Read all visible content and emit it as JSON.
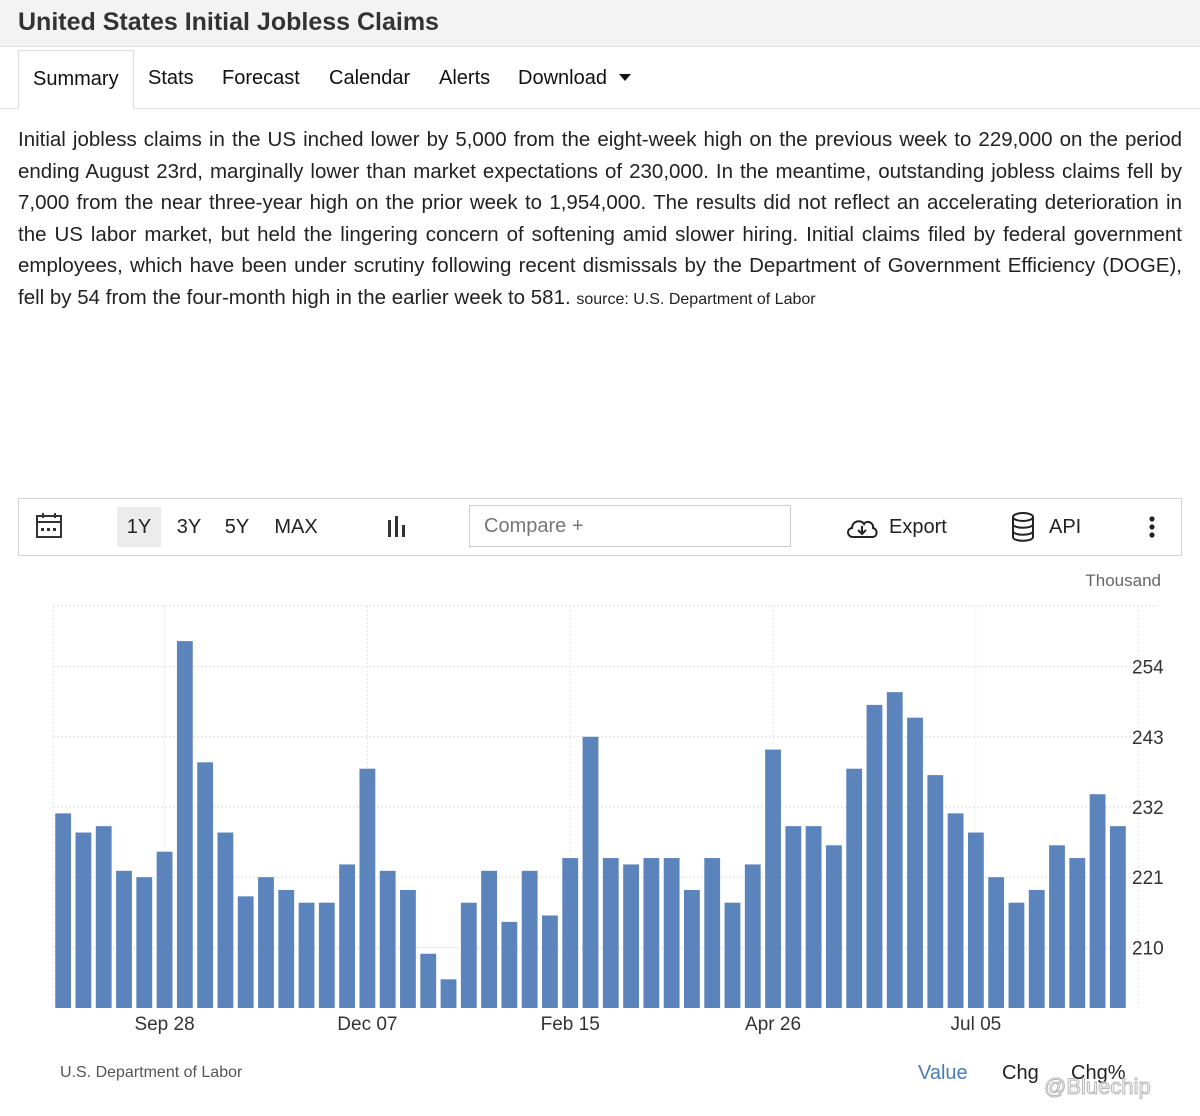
{
  "page": {
    "title": "United States Initial Jobless Claims"
  },
  "tabs": [
    {
      "label": "Summary"
    },
    {
      "label": "Stats"
    },
    {
      "label": "Forecast"
    },
    {
      "label": "Calendar"
    },
    {
      "label": "Alerts"
    },
    {
      "label": "Download"
    }
  ],
  "description": {
    "text": "Initial jobless claims in the US inched lower by 5,000 from the eight-week high on the previous week to 229,000 on the period ending August 23rd, marginally lower than market expectations of 230,000. In the meantime, outstanding jobless claims fell by 7,000 from the near three-year high on the prior week to 1,954,000. The results did not reflect an accelerating deterioration in the US labor market, but held the lingering concern of softening amid slower hiring. Initial claims filed by federal government employees, which have been under scrutiny following recent dismissals by the Department of Government Efficiency (DOGE), fell by 54 from the four-month high in the earlier week to 581.",
    "source": "source: U.S. Department of Labor"
  },
  "toolbar": {
    "ranges": [
      "1Y",
      "3Y",
      "5Y",
      "MAX"
    ],
    "selected_range": "1Y",
    "compare_placeholder": "Compare +",
    "export_label": "Export",
    "api_label": "API",
    "icons": [
      "calendar-icon",
      "bar-chart-icon",
      "cloud-download-icon",
      "database-icon",
      "more-vertical-icon"
    ]
  },
  "chart_data": {
    "type": "bar",
    "unit_label": "Thousand",
    "color": "#5b84bd",
    "x_tick_labels": [
      "Sep 28",
      "Dec 07",
      "Feb 15",
      "Apr 26",
      "Jul 05"
    ],
    "x_tick_bar_index": [
      5,
      15,
      25,
      35,
      45
    ],
    "y_ticks": [
      210,
      221,
      232,
      243,
      254
    ],
    "ylim": [
      200.5,
      263.5
    ],
    "grid": true,
    "values": [
      231,
      228,
      229,
      222,
      221,
      225,
      258,
      239,
      228,
      218,
      221,
      219,
      217,
      217,
      223,
      238,
      222,
      219,
      209,
      205,
      217,
      222,
      214,
      222,
      215,
      224,
      243,
      224,
      223,
      224,
      224,
      219,
      224,
      217,
      223,
      241,
      229,
      229,
      226,
      238,
      248,
      250,
      246,
      237,
      231,
      228,
      221,
      217,
      219,
      226,
      224,
      234,
      229
    ]
  },
  "footer": {
    "source": "U.S. Department of Labor",
    "tabs": [
      "Value",
      "Chg",
      "Chg%"
    ],
    "active_tab": "Value",
    "watermark": "@Bluechip"
  }
}
